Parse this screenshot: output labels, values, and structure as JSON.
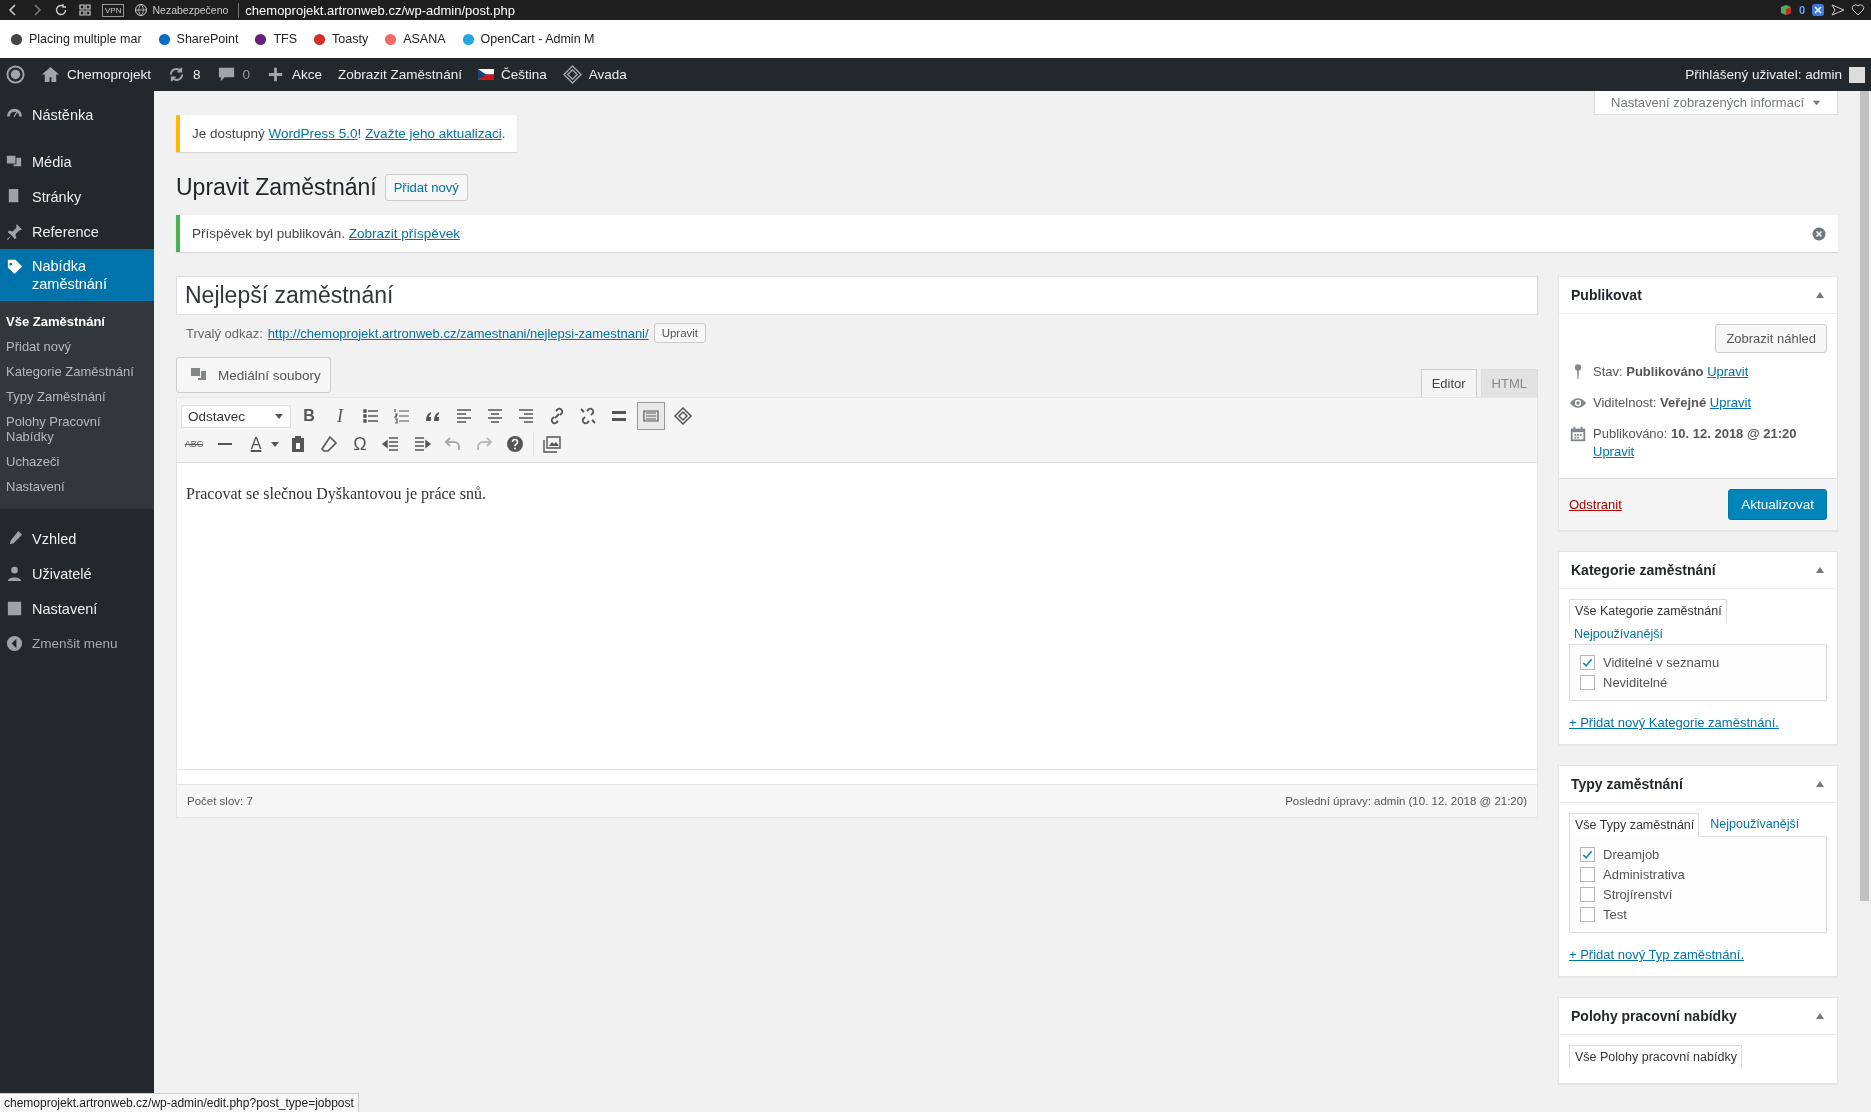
{
  "browser": {
    "vpn": "VPN",
    "security": "Nezabezpečeno",
    "url": "chemoprojekt.artronweb.cz/wp-admin/post.php",
    "badge_count": "0"
  },
  "bookmarks": [
    {
      "label": "Placing multiple mar",
      "color": "#444444"
    },
    {
      "label": "SharePoint",
      "color": "#0a6fc2"
    },
    {
      "label": "TFS",
      "color": "#68217a"
    },
    {
      "label": "Toasty",
      "color": "#d32f2f"
    },
    {
      "label": "ASANA",
      "color": "#f06a6a"
    },
    {
      "label": "OpenCart - Admin M",
      "color": "#23a8e0"
    }
  ],
  "admin_bar": {
    "site": "Chemoprojekt",
    "updates": "8",
    "comments": "0",
    "new": "Akce",
    "view": "Zobrazit Zaměstnání",
    "language": "Čeština",
    "theme": "Avada",
    "user": "Přihlášený uživatel: admin"
  },
  "sidebar": {
    "items": [
      {
        "label": "Nástěnka",
        "selected": false
      },
      {
        "label": "Média",
        "selected": false
      },
      {
        "label": "Stránky",
        "selected": false
      },
      {
        "label": "Reference",
        "selected": false
      },
      {
        "label": "Nabídka zaměstnání",
        "selected": true,
        "children": [
          {
            "label": "Vše Zaměstnání",
            "selected": true
          },
          {
            "label": "Přidat nový",
            "selected": false
          },
          {
            "label": "Kategorie Zaměstnání",
            "selected": false
          },
          {
            "label": "Typy Zaměstnání",
            "selected": false
          },
          {
            "label": "Polohy Pracovní Nabídky",
            "selected": false
          },
          {
            "label": "Uchazeči",
            "selected": false
          },
          {
            "label": "Nastavení",
            "selected": false
          }
        ]
      },
      {
        "label": "Vzhled",
        "selected": false
      },
      {
        "label": "Uživatelé",
        "selected": false
      },
      {
        "label": "Nastavení",
        "selected": false
      }
    ],
    "collapse": "Zmenšit menu"
  },
  "screen_options": "Nastavení zobrazených informací",
  "update_notice": {
    "before": "Je dostupný ",
    "link": "WordPress 5.0",
    "middle": "! ",
    "link2": "Zvažte jeho aktualizaci",
    "after": "."
  },
  "heading": "Upravit Zaměstnání",
  "add_new": "Přidat nový",
  "published_notice": {
    "text": "Příspěvek byl publikován.",
    "link": "Zobrazit příspěvek"
  },
  "post_title": "Nejlepší zaměstnání",
  "permalink": {
    "label": "Trvalý odkaz:",
    "url": "http://chemoprojekt.artronweb.cz/zamestnani/nejlepsi-zamestnani/",
    "edit": "Upravit"
  },
  "media_button": "Mediální soubory",
  "editor_tabs": [
    {
      "label": "Editor",
      "selected": true
    },
    {
      "label": "HTML",
      "selected": false
    }
  ],
  "toolbar": {
    "format": "Odstavec",
    "bold": "B",
    "italic": "I",
    "text_color": "A",
    "strikethrough": "ABC",
    "special_char": "Ω",
    "toggle_on": true
  },
  "content": "Pracovat se slečnou Dyškantovou je práce snů.",
  "editor_status": {
    "word_count": "Počet slov: 7",
    "last_edit": "Poslední úpravy: admin (10. 12. 2018 @ 21:20)"
  },
  "publish": {
    "title": "Publikovat",
    "preview": "Zobrazit náhled",
    "rows": [
      {
        "kind": "status",
        "text": "Stav: **Publikováno**",
        "link": "Upravit"
      },
      {
        "kind": "visibility",
        "text": "Viditelnost: **Veřejné**",
        "link": "Upravit"
      },
      {
        "kind": "date",
        "text": "Publikováno: **10. 12. 2018 @ 21:20**",
        "link": "Upravit"
      }
    ],
    "delete": "Odstranit",
    "update": "Aktualizovat"
  },
  "taxonomies": [
    {
      "title": "Kategorie zaměstnání",
      "tabs": [
        {
          "label": "Vše Kategorie zaměstnání",
          "selected": true
        },
        {
          "label": "Nejpoužívanější",
          "selected": false
        }
      ],
      "items": [
        {
          "label": "Viditelné v seznamu",
          "checked": true
        },
        {
          "label": "Neviditelné",
          "checked": false
        }
      ],
      "add_link": "+ Přidat nový Kategorie zaměstnání."
    },
    {
      "title": "Typy zaměstnání",
      "tabs": [
        {
          "label": "Vše Typy zaměstnání",
          "selected": true
        },
        {
          "label": "Nejpoužívanější",
          "selected": false
        }
      ],
      "items": [
        {
          "label": "Dreamjob",
          "checked": true
        },
        {
          "label": "Administrativa",
          "checked": false
        },
        {
          "label": "Strojírenství",
          "checked": false
        },
        {
          "label": "Test",
          "checked": false
        }
      ],
      "add_link": "+ Přidat nový Typ zaměstnání."
    },
    {
      "title": "Polohy pracovní nabídky",
      "tabs": [
        {
          "label": "Vše Polohy pracovní nabídky",
          "selected": true
        }
      ]
    }
  ],
  "status_url": "chemoprojekt.artronweb.cz/wp-admin/edit.php?post_type=jobpost"
}
